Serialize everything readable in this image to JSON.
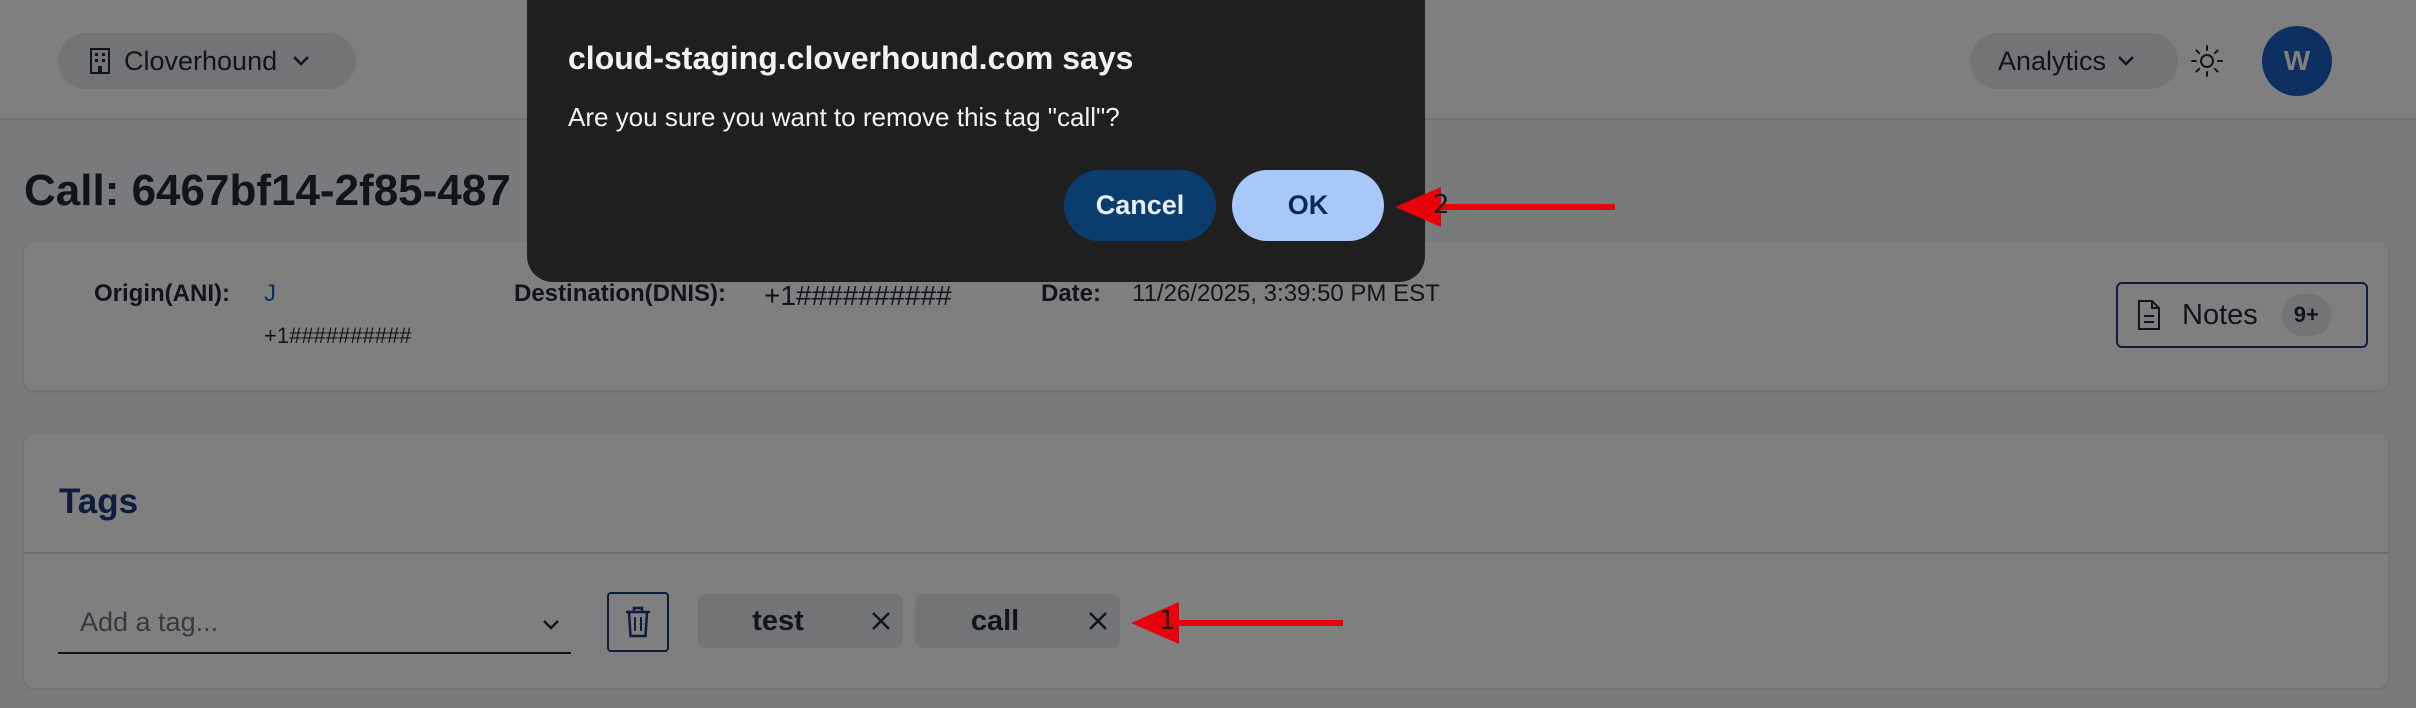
{
  "header": {
    "org_name": "Cloverhound",
    "analytics_label": "Analytics",
    "avatar_initial": "W",
    "icons": [
      "building-icon",
      "chevron-down-icon",
      "sun-icon"
    ]
  },
  "page": {
    "title": "Call: 6467bf14-2f85-487"
  },
  "call_info": {
    "origin_label": "Origin(ANI):",
    "origin_name": "J",
    "origin_number": "+1##########",
    "destination_label": "Destination(DNIS):",
    "destination_number": "+1##########",
    "date_label": "Date:",
    "date_value": "11/26/2025, 3:39:50 PM EST",
    "notes_label": "Notes",
    "notes_count": "9+"
  },
  "tags": {
    "title": "Tags",
    "input_placeholder": "Add a tag...",
    "items": [
      {
        "label": "test"
      },
      {
        "label": "call"
      }
    ]
  },
  "dialog": {
    "title": "cloud-staging.cloverhound.com says",
    "message": "Are you sure you want to remove this tag \"call\"?",
    "cancel_label": "Cancel",
    "ok_label": "OK"
  },
  "annotations": [
    {
      "number": "1",
      "color": "#e8000b"
    },
    {
      "number": "2",
      "color": "#e8000b"
    }
  ]
}
